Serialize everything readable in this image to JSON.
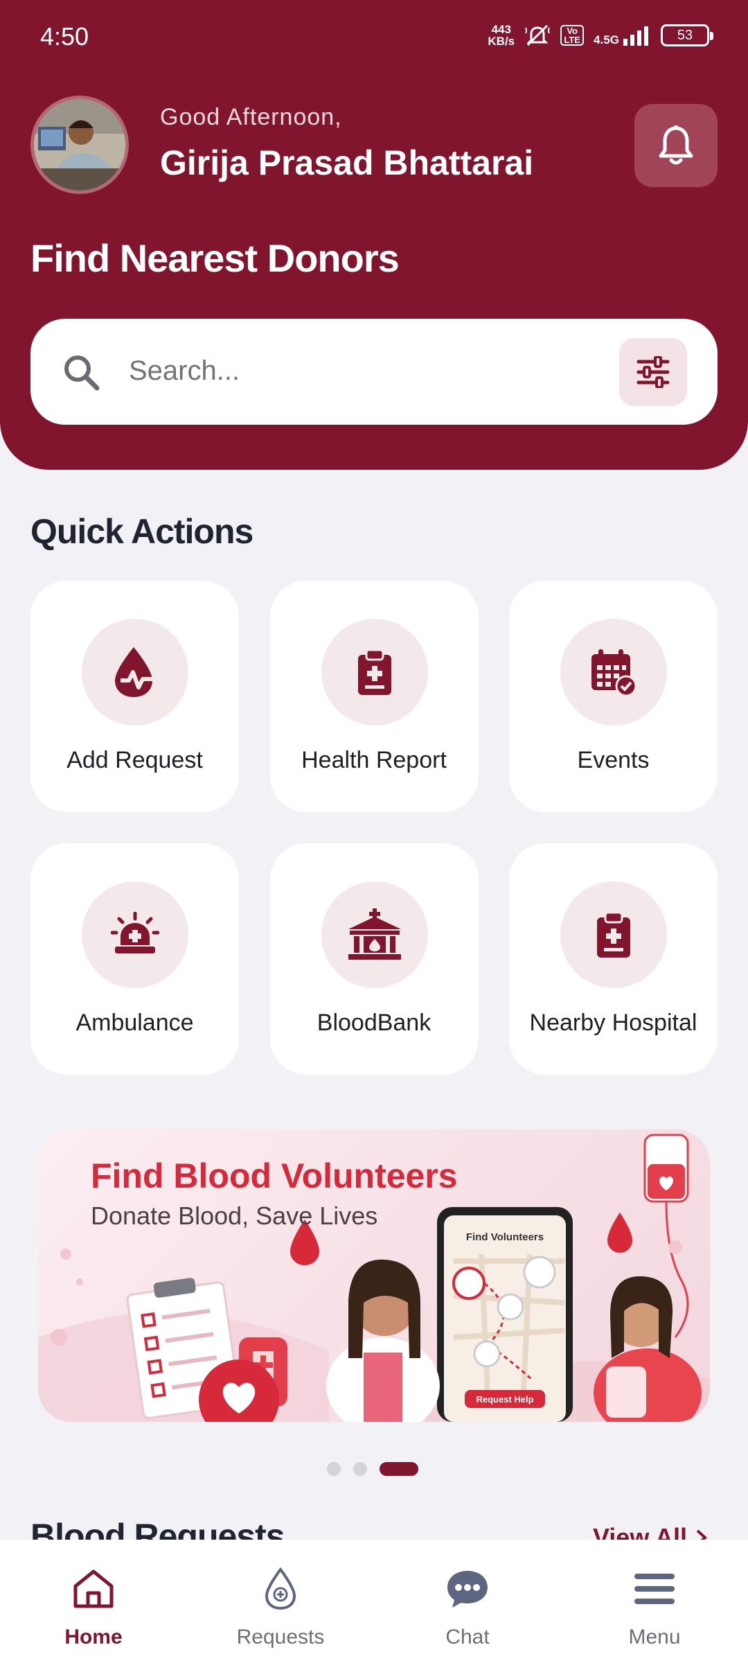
{
  "status_bar": {
    "time": "4:50",
    "net_speed_top": "443",
    "net_speed_bottom": "KB/s",
    "network": "4.5G",
    "volte": "Vo LTE",
    "battery": "53"
  },
  "header": {
    "greeting": "Good Afternoon,",
    "user_name": "Girija Prasad Bhattarai",
    "title": "Find Nearest Donors",
    "search_placeholder": "Search..."
  },
  "quick_actions": {
    "title": "Quick Actions",
    "items": [
      {
        "label": "Add Request",
        "icon": "blood-drop-pulse-icon"
      },
      {
        "label": "Health Report",
        "icon": "clipboard-plus-icon"
      },
      {
        "label": "Events",
        "icon": "calendar-check-icon"
      },
      {
        "label": "Ambulance",
        "icon": "siren-icon"
      },
      {
        "label": "BloodBank",
        "icon": "bank-building-icon"
      },
      {
        "label": "Nearby Hospital",
        "icon": "clipboard-plus-icon"
      }
    ]
  },
  "banner": {
    "title": "Find Blood Volunteers",
    "subtitle": "Donate Blood, Save Lives",
    "phone_title": "Find Volunteers",
    "phone_button": "Request Help"
  },
  "carousel": {
    "count": 3,
    "active": 3
  },
  "blood_requests": {
    "title": "Blood Requests",
    "view_all": "View All"
  },
  "nav": {
    "items": [
      {
        "label": "Home",
        "icon": "home-icon",
        "active": true
      },
      {
        "label": "Requests",
        "icon": "blood-drop-plus-icon",
        "active": false
      },
      {
        "label": "Chat",
        "icon": "chat-bubble-icon",
        "active": false
      },
      {
        "label": "Menu",
        "icon": "menu-icon",
        "active": false
      }
    ]
  },
  "colors": {
    "primary": "#82152e",
    "accent": "#d6293a",
    "background": "#f2f2f6",
    "icon_circle": "#f3e8ea"
  }
}
